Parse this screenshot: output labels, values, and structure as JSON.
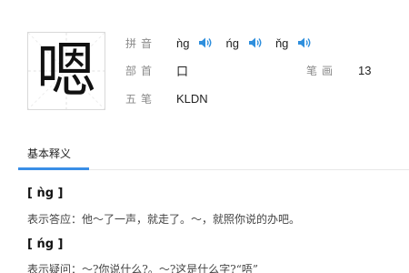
{
  "character": {
    "glyph": "嗯"
  },
  "info": {
    "pinyin_label": "拼音",
    "pinyin": [
      {
        "text": "ǹg",
        "icon": "speaker-icon"
      },
      {
        "text": "ńg",
        "icon": "speaker-icon"
      },
      {
        "text": "ňg",
        "icon": "speaker-icon"
      }
    ],
    "radical_label": "部首",
    "radical_value": "口",
    "strokes_label": "笔画",
    "strokes_value": "13",
    "wubi_label": "五笔",
    "wubi_value": "KLDN"
  },
  "tabs": {
    "active_label": "基本释义"
  },
  "definitions": [
    {
      "pinyin_header": "[ ǹg ]",
      "text": "表示答应：他～了一声，就走了。～，就照你说的办吧。"
    },
    {
      "pinyin_header": "[ ńg ]",
      "text": "表示疑问：～?你说什么?。～?这是什么字?“唔”"
    }
  ],
  "colors": {
    "accent": "#3a8ee6",
    "speaker": "#2f8fdd"
  }
}
